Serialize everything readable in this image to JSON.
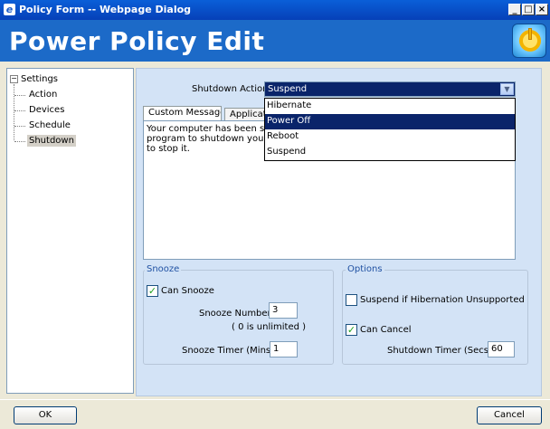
{
  "window": {
    "title": "Policy Form -- Webpage Dialog",
    "minimize": "_",
    "maximize": "□",
    "close": "×",
    "app_icon": "ie-icon"
  },
  "header": {
    "title": "Power Policy Edit",
    "logo_icon": "power-icon"
  },
  "tree": {
    "root_label": "Settings",
    "expander": "−",
    "items": [
      {
        "label": "Action"
      },
      {
        "label": "Devices"
      },
      {
        "label": "Schedule"
      },
      {
        "label": "Shutdown",
        "selected": true
      }
    ]
  },
  "shutdown": {
    "label": "Shutdown Action",
    "selected": "Suspend",
    "options": [
      "Hibernate",
      "Power Off",
      "Reboot",
      "Suspend"
    ],
    "highlighted": "Power Off"
  },
  "tabs": [
    {
      "label": "Custom Message"
    },
    {
      "label": "Application"
    }
  ],
  "message": {
    "lines": [
      "Your computer has been sche",
      "program to shutdown your co",
      "to stop it."
    ]
  },
  "snooze": {
    "title": "Snooze",
    "can_snooze_label": "Can Snooze",
    "can_snooze_checked": true,
    "number_label": "Snooze Number:",
    "number_value": "3",
    "unlimited_note": "( 0 is unlimited )",
    "timer_label": "Snooze Timer (Mins)",
    "timer_value": "1"
  },
  "options": {
    "title": "Options",
    "suspend_label": "Suspend if Hibernation Unsupported",
    "suspend_checked": false,
    "can_cancel_label": "Can Cancel",
    "can_cancel_checked": true,
    "timer_label": "Shutdown Timer (Secs):",
    "timer_value": "60"
  },
  "buttons": {
    "ok": "OK",
    "cancel": "Cancel"
  }
}
